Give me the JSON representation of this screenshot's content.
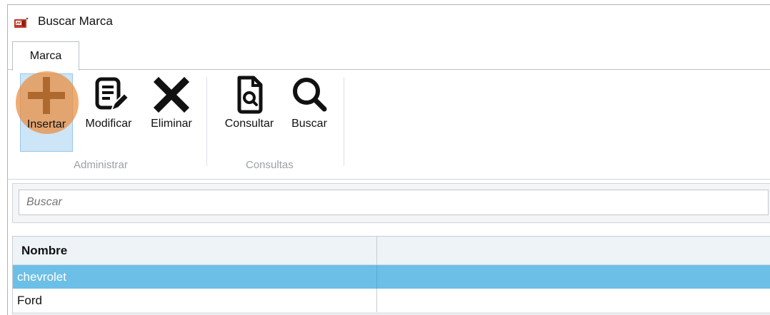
{
  "window": {
    "title": "Buscar Marca",
    "icon": "app-window-icon"
  },
  "ribbon": {
    "tab": "Marca",
    "groups": [
      {
        "label": "Administrar",
        "buttons": [
          {
            "label": "Insertar",
            "icon": "plus-icon",
            "selected": true
          },
          {
            "label": "Modificar",
            "icon": "edit-document-icon"
          },
          {
            "label": "Eliminar",
            "icon": "delete-x-icon"
          }
        ]
      },
      {
        "label": "Consultas",
        "buttons": [
          {
            "label": "Consultar",
            "icon": "document-search-icon"
          },
          {
            "label": "Buscar",
            "icon": "magnifier-icon"
          }
        ]
      }
    ],
    "highlight_color": "#eb8c3c"
  },
  "search": {
    "placeholder": "Buscar",
    "value": ""
  },
  "grid": {
    "columns": [
      "Nombre",
      ""
    ],
    "rows": [
      {
        "nombre": "chevrolet",
        "selected": true
      },
      {
        "nombre": "Ford",
        "selected": false
      }
    ],
    "selection_color": "#6cbfe6"
  }
}
